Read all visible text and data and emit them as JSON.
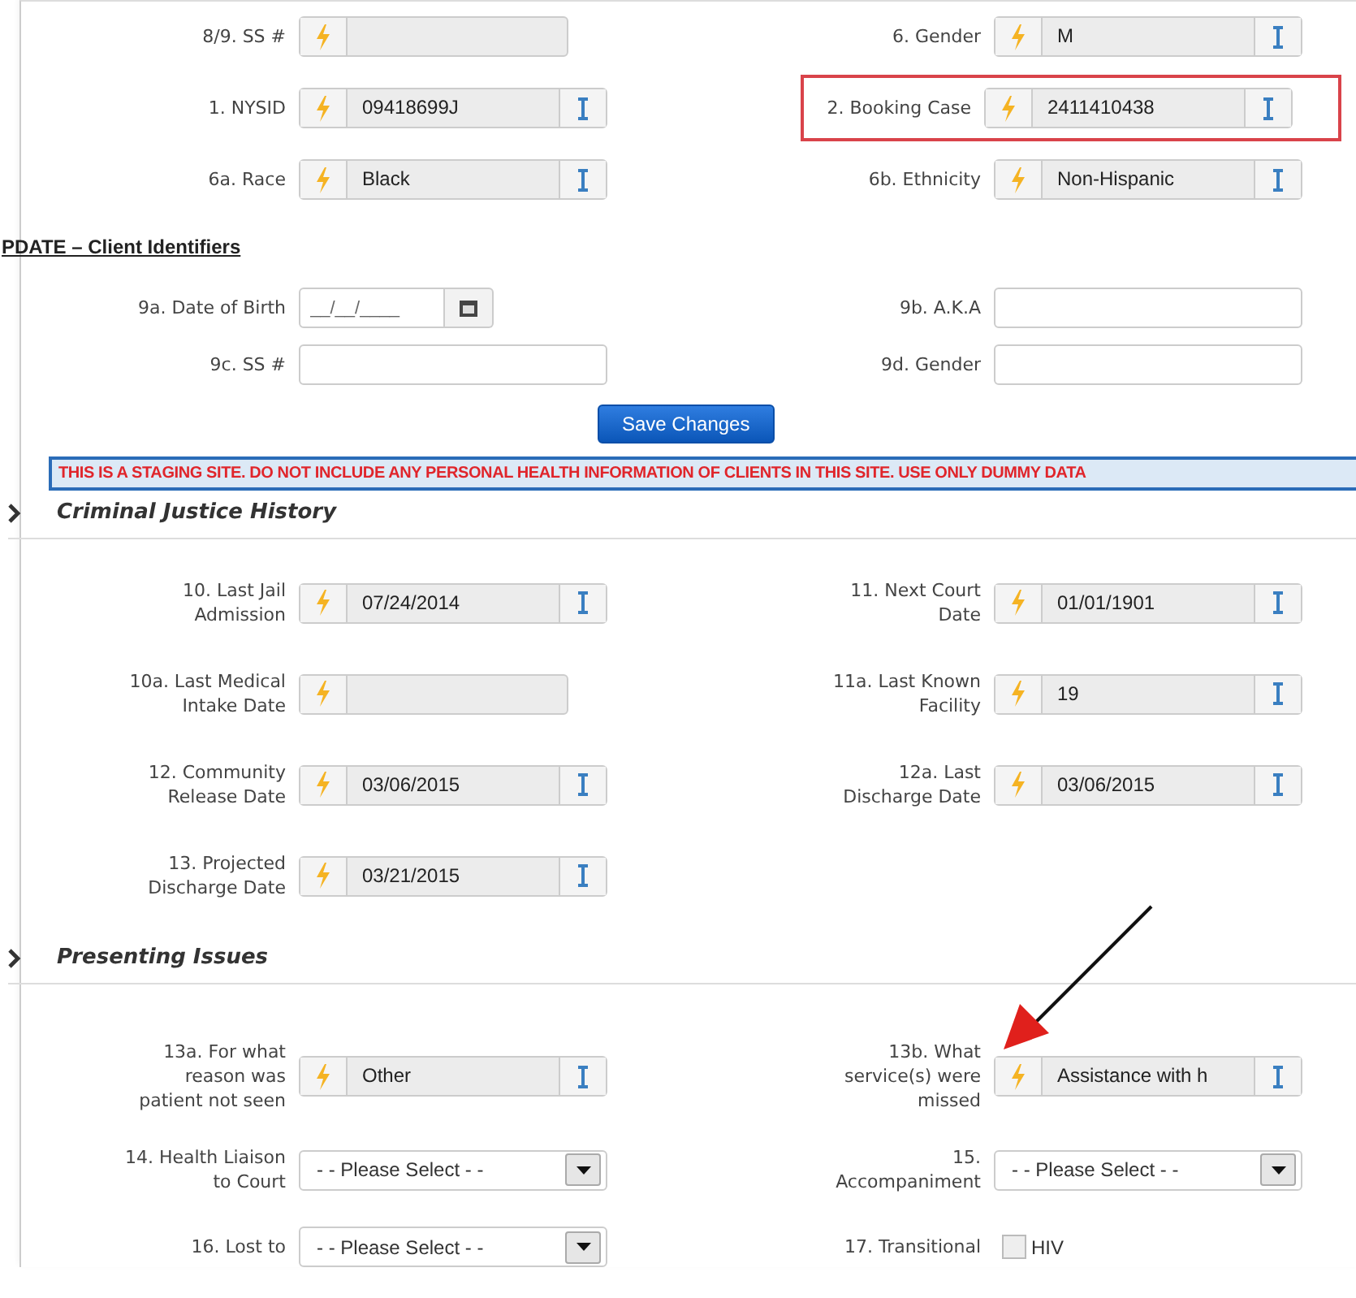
{
  "identifiers": {
    "rows": [
      {
        "left": {
          "label": "8/9. SS #",
          "kind": "locked",
          "info": false
        },
        "right": {
          "label": "6. Gender",
          "kind": "locked",
          "value": "M",
          "info": true
        }
      },
      {
        "left": {
          "label": "1. NYSID",
          "kind": "locked",
          "value": "09418699J",
          "info": true
        },
        "right": {
          "label": "2. Booking Case",
          "kind": "locked",
          "value": "2411410438",
          "info": true,
          "highlighted": true
        }
      },
      {
        "left": {
          "label": "6a. Race",
          "kind": "locked",
          "value": "Black",
          "info": true
        },
        "right": {
          "label": "6b. Ethnicity",
          "kind": "locked",
          "value": "Non-Hispanic",
          "info": true
        }
      }
    ]
  },
  "update_section": {
    "title": "PDATE – Client Identifiers",
    "rows": [
      {
        "left": {
          "label": "9a. Date of Birth",
          "kind": "date",
          "placeholder": "__/__/____"
        },
        "right": {
          "label": "9b. A.K.A",
          "kind": "text"
        }
      },
      {
        "left": {
          "label": "9c. SS #",
          "kind": "text"
        },
        "right": {
          "label": "9d. Gender",
          "kind": "text"
        }
      }
    ],
    "save_button": "Save Changes"
  },
  "banner": "THIS IS A STAGING SITE. DO NOT INCLUDE ANY PERSONAL HEALTH INFORMATION OF CLIENTS IN THIS SITE. USE ONLY DUMMY DATA",
  "criminal_justice_history": {
    "title": "Criminal Justice History",
    "rows": [
      {
        "left": {
          "label": "10. Last Jail Admission",
          "kind": "locked",
          "value": "07/24/2014",
          "info": true
        },
        "right": {
          "label": "11. Next Court Date",
          "kind": "locked",
          "value": "01/01/1901",
          "info": true
        }
      },
      {
        "left": {
          "label": "10a. Last Medical Intake Date",
          "kind": "locked",
          "info": false
        },
        "right": {
          "label": "11a. Last Known Facility",
          "kind": "locked",
          "value": "19",
          "info": true
        }
      },
      {
        "left": {
          "label": "12. Community Release Date",
          "kind": "locked",
          "value": "03/06/2015",
          "info": true
        },
        "right": {
          "label": "12a. Last Discharge Date",
          "kind": "locked",
          "value": "03/06/2015",
          "info": true
        }
      },
      {
        "left": {
          "label": "13. Projected Discharge Date",
          "kind": "locked",
          "value": "03/21/2015",
          "info": true
        }
      }
    ]
  },
  "presenting_issues": {
    "title": "Presenting Issues",
    "rows": [
      {
        "left": {
          "label": "13a. For what reason was patient not seen",
          "kind": "locked",
          "value": "Other",
          "info": true
        },
        "right": {
          "label": "13b. What service(s) were missed",
          "kind": "locked",
          "value": "Assistance with h",
          "info": true,
          "pointed": true
        }
      },
      {
        "left": {
          "label": "14. Health Liaison to Court",
          "kind": "select",
          "value": "- - Please Select - -"
        },
        "right": {
          "label": "15. Accompaniment",
          "kind": "select",
          "value": "- - Please Select - -"
        }
      },
      {
        "left": {
          "label": "16. Lost to",
          "kind": "select",
          "value": "- - Please Select - -"
        },
        "right": {
          "label": "17. Transitional",
          "kind": "checkbox",
          "option": "HIV",
          "checked": false
        }
      }
    ]
  }
}
